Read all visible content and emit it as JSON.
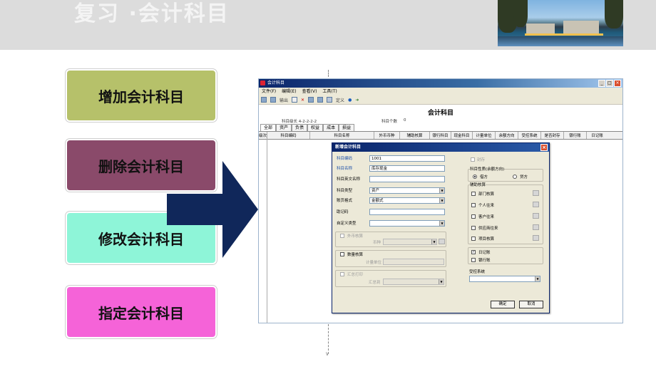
{
  "slide": {
    "title": "复习 ·会计科目"
  },
  "menu": [
    {
      "label": "增加会计科目",
      "color": "#b6c16a"
    },
    {
      "label": "删除会计科目",
      "color": "#8a4a6a"
    },
    {
      "label": "修改会计科目",
      "color": "#8ef5d8"
    },
    {
      "label": "指定会计科目",
      "color": "#f563d8"
    }
  ],
  "colors": {
    "arrow": "#10275a",
    "window_title": "#0a246a"
  },
  "window": {
    "title": "会计科目",
    "menubar": [
      "文件(F)",
      "编辑(E)",
      "查看(V)",
      "工具(T)"
    ],
    "toolbar": {
      "print": "输出",
      "define": "定义"
    },
    "doc_title": "会计科目",
    "code_length": "科目级长 4-2-2-2-2",
    "count_label": "科目个数",
    "count": "0",
    "tabs": [
      "全部",
      "资产",
      "负债",
      "权益",
      "成本",
      "损益"
    ],
    "columns": [
      "级次",
      "科目编码",
      "科目名称",
      "外币币种",
      "辅助核算",
      "银行科目",
      "现金科目",
      "计量单位",
      "余额方向",
      "受控系统",
      "是否封存",
      "银行账",
      "日记账"
    ]
  },
  "dialog": {
    "title": "新增会计科目",
    "labels": {
      "code": "科目编码",
      "name": "科目名称",
      "en_name": "科目英文名称",
      "type": "科目类型",
      "format": "账页格式",
      "mnemonic": "助记码",
      "custom_type": "自定义类型",
      "foreign": "外币核算",
      "currency": "币种",
      "quantity": "数量核算",
      "unit": "计量单位",
      "summary_print": "汇总打印",
      "summary_to": "汇总到",
      "sealed": "封存",
      "direction": "科目性质(余额方向)",
      "debit": "借方",
      "credit": "贷方",
      "aux": "辅助核算",
      "dept": "部门核算",
      "person": "个人往来",
      "customer": "客户往来",
      "supplier": "供应商往来",
      "project": "项目核算",
      "journal": "日记账",
      "bank": "银行账",
      "controlled": "受控系统"
    },
    "values": {
      "code": "1001",
      "name": "库存现金",
      "en_name": "",
      "type": "资产",
      "format": "金额式",
      "mnemonic": "",
      "custom_type": ""
    },
    "buttons": {
      "ok": "确定",
      "cancel": "取消"
    }
  }
}
